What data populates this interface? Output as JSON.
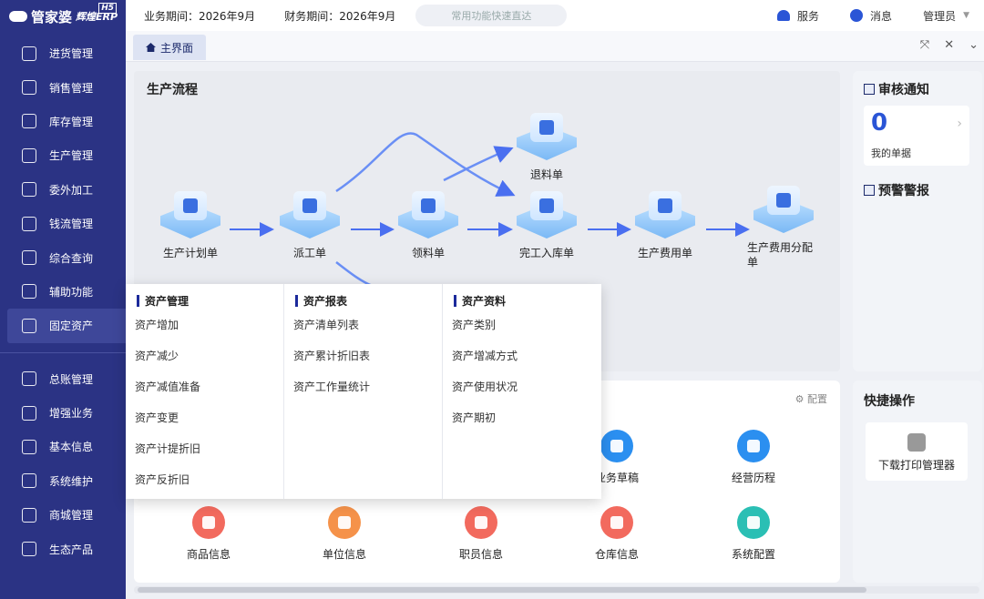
{
  "logo": {
    "name": "管家婆",
    "sub": "辉煌ERP",
    "badge": "H5"
  },
  "sidebar": {
    "items": [
      {
        "label": "进货管理",
        "icon": "cart-icon"
      },
      {
        "label": "销售管理",
        "icon": "sales-icon"
      },
      {
        "label": "库存管理",
        "icon": "box-icon"
      },
      {
        "label": "生产管理",
        "icon": "production-icon"
      },
      {
        "label": "委外加工",
        "icon": "house-icon"
      },
      {
        "label": "钱流管理",
        "icon": "money-icon"
      },
      {
        "label": "综合查询",
        "icon": "query-icon"
      },
      {
        "label": "辅助功能",
        "icon": "assist-icon"
      },
      {
        "label": "固定资产",
        "icon": "asset-icon",
        "active": true
      }
    ],
    "items2": [
      {
        "label": "总账管理",
        "icon": "ledger-icon"
      },
      {
        "label": "增强业务",
        "icon": "enhance-icon"
      },
      {
        "label": "基本信息",
        "icon": "doc-icon"
      },
      {
        "label": "系统维护",
        "icon": "maintenance-icon"
      },
      {
        "label": "商城管理",
        "icon": "shop-icon"
      },
      {
        "label": "生态产品",
        "icon": "eco-icon"
      }
    ]
  },
  "topbar": {
    "business_period": "业务期间：2026年9月",
    "finance_period": "财务期间：2026年9月",
    "quick_placeholder": "常用功能快速直达",
    "service": "服务",
    "message": "消息",
    "admin": "管理员"
  },
  "tab": {
    "label": "主界面"
  },
  "flow": {
    "title": "生产流程",
    "nodes": [
      "生产计划单",
      "派工单",
      "领料单",
      "退料单",
      "完工入库单",
      "生产费用单",
      "生产费用分配单"
    ]
  },
  "audit": {
    "title": "审核通知",
    "count": "0",
    "caption": "我的单据",
    "warning_title": "预警警报"
  },
  "bottom": {
    "config": "配置",
    "apps_row1": [
      {
        "label": "业务草稿",
        "color": "#2b8ff0"
      },
      {
        "label": "经营历程",
        "color": "#2b8ff0"
      }
    ],
    "apps_row2": [
      {
        "label": "商品信息",
        "color": "#f26a5e"
      },
      {
        "label": "单位信息",
        "color": "#f5924a"
      },
      {
        "label": "职员信息",
        "color": "#f26a5e"
      },
      {
        "label": "仓库信息",
        "color": "#f26a5e"
      },
      {
        "label": "系统配置",
        "color": "#2bbfb4"
      }
    ]
  },
  "quick_ops": {
    "title": "快捷操作",
    "card": "下载打印管理器"
  },
  "dropdown": {
    "col1": {
      "title": "资产管理",
      "items": [
        "资产增加",
        "资产减少",
        "资产减值准备",
        "资产变更",
        "资产计提折旧",
        "资产反折旧"
      ]
    },
    "col2": {
      "title": "资产报表",
      "items": [
        "资产清单列表",
        "资产累计折旧表",
        "资产工作量统计"
      ]
    },
    "col3": {
      "title": "资产资料",
      "items": [
        "资产类别",
        "资产增减方式",
        "资产使用状况",
        "资产期初"
      ]
    }
  }
}
